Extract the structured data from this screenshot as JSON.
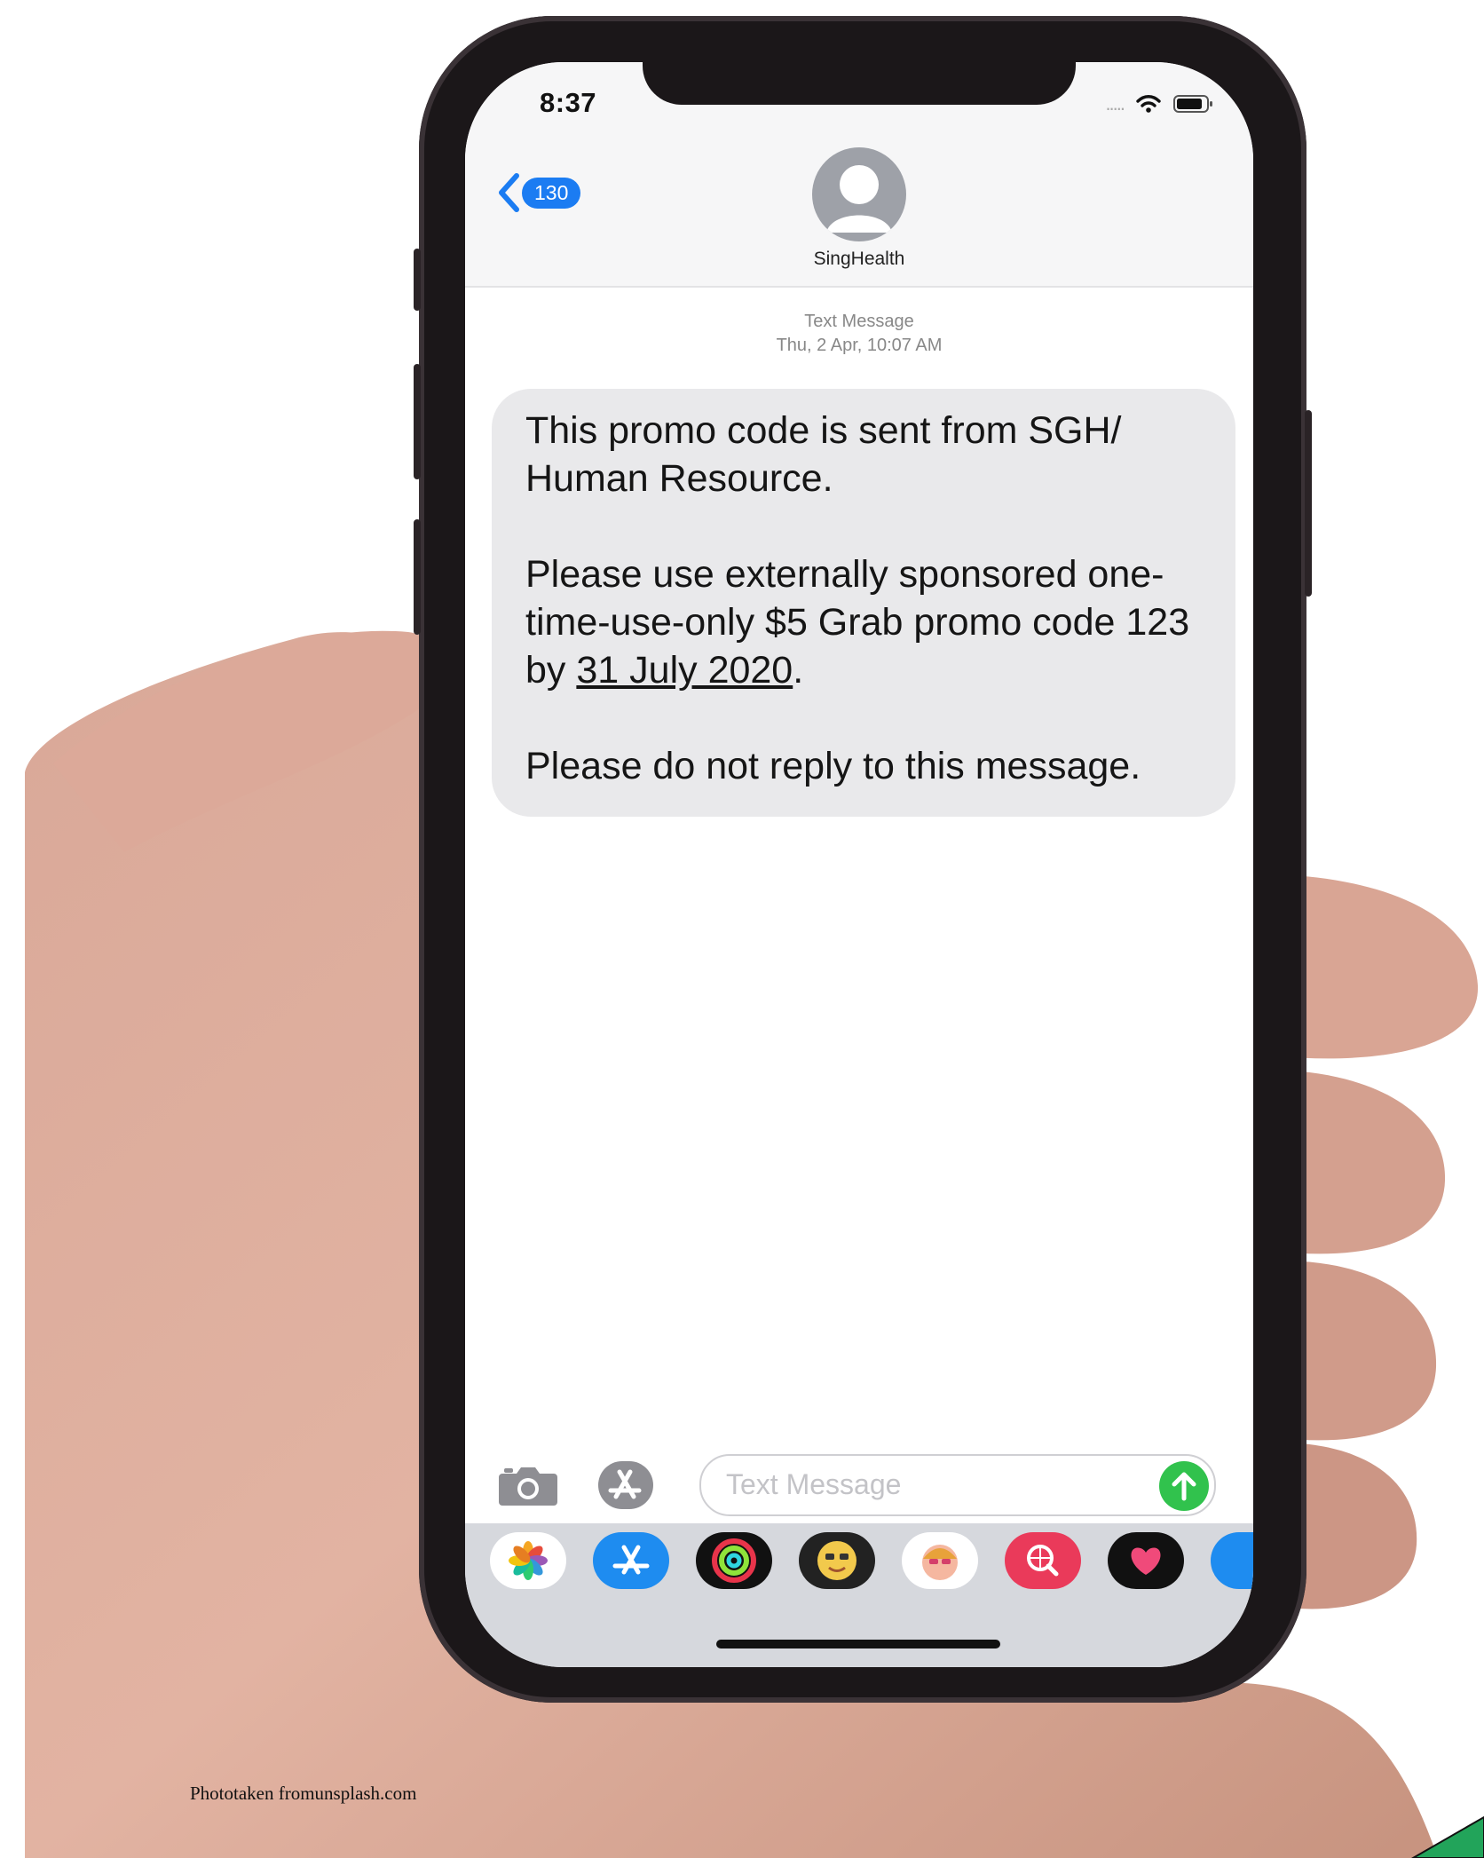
{
  "status_bar": {
    "time": "8:37",
    "signal": "....."
  },
  "header": {
    "back_count": "130",
    "contact_name": "SingHealth"
  },
  "message": {
    "meta_label": "Text Message",
    "meta_date": "Thu, 2 Apr, 10:07 AM",
    "line1": "This promo code is sent from SGH/ Human Resource.",
    "line2_part1": "Please use externally sponsored one-time-use-only $5 Grab promo code 123 by ",
    "line2_link": "31 July 2020",
    "line2_end": ".",
    "line3": "Please do not reply to this message."
  },
  "composer": {
    "placeholder": "Text Message"
  },
  "apps": [
    "photos-app-icon",
    "app-store-icon",
    "activity-icon",
    "memoji-icon",
    "memoji-sticker-icon",
    "web-search-icon",
    "heart-music-icon",
    "more-app-icon"
  ],
  "credit": "Phototaken fromunsplash.com",
  "colors": {
    "accent": "#1b7cf2",
    "send": "#31c24d",
    "bubble": "#e9e9eb"
  }
}
